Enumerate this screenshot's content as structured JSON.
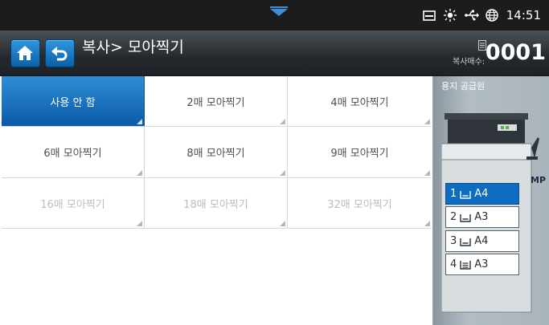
{
  "status_bar": {
    "time": "14:51",
    "icons": [
      "pull-down-handle-icon",
      "tray-icon",
      "brightness-icon",
      "usb-icon",
      "globe-icon"
    ]
  },
  "header": {
    "title": "복사> 모아찍기",
    "counter_label": "복사매수:",
    "counter_value": "0001",
    "icons": [
      "home-icon",
      "back-icon",
      "counter-icon"
    ]
  },
  "options": [
    [
      {
        "label": "사용 안 함",
        "state": "selected"
      },
      {
        "label": "2매 모아찍기",
        "state": "normal"
      },
      {
        "label": "4매 모아찍기",
        "state": "normal"
      }
    ],
    [
      {
        "label": "6매 모아찍기",
        "state": "normal"
      },
      {
        "label": "8매 모아찍기",
        "state": "normal"
      },
      {
        "label": "9매 모아찍기",
        "state": "normal"
      }
    ],
    [
      {
        "label": "16매 모아찍기",
        "state": "disabled"
      },
      {
        "label": "18매 모아찍기",
        "state": "disabled"
      },
      {
        "label": "32매 모아찍기",
        "state": "disabled"
      }
    ]
  ],
  "paper_source": {
    "title": "용지 공급원",
    "mp_label": "MP",
    "trays": [
      {
        "number": "1",
        "size": "A4",
        "active": true
      },
      {
        "number": "2",
        "size": "A3",
        "active": false
      },
      {
        "number": "3",
        "size": "A4",
        "active": false
      },
      {
        "number": "4",
        "size": "A3",
        "active": false
      }
    ]
  },
  "colors": {
    "accent_blue": "#0d6cbf",
    "header_dark": "#24292d",
    "status_bar": "#1c1c1c",
    "panel_gray": "#aab4bb",
    "disabled_text": "#b9bdc0"
  }
}
